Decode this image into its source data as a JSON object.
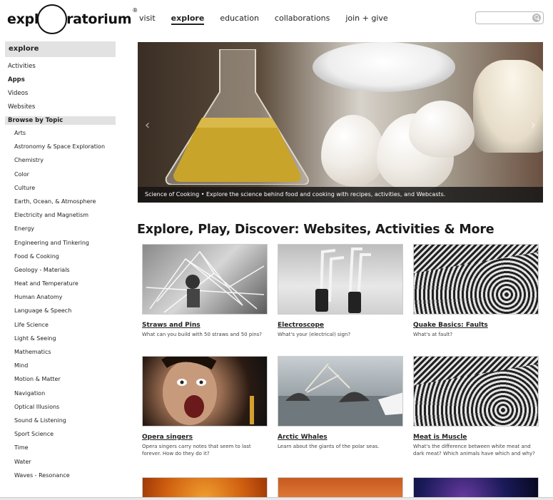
{
  "header": {
    "logo_left": "expl",
    "logo_right": "ratorium",
    "logo_mark": "®",
    "nav": [
      {
        "label": "visit",
        "active": false
      },
      {
        "label": "explore",
        "active": true
      },
      {
        "label": "education",
        "active": false
      },
      {
        "label": "collaborations",
        "active": false
      },
      {
        "label": "join + give",
        "active": false
      }
    ],
    "search_placeholder": "",
    "search_icon": "search-icon"
  },
  "sidebar": {
    "heading": "explore",
    "items": [
      {
        "label": "Activities",
        "bold": false
      },
      {
        "label": "Apps",
        "bold": true
      },
      {
        "label": "Videos",
        "bold": false
      },
      {
        "label": "Websites",
        "bold": false
      }
    ],
    "section": "Browse by Topic",
    "topics": [
      "Arts",
      "Astronomy & Space Exploration",
      "Chemistry",
      "Color",
      "Culture",
      "Earth, Ocean, & Atmosphere",
      "Electricity and Magnetism",
      "Energy",
      "Engineering and Tinkering",
      "Food & Cooking",
      "Geology - Materials",
      "Heat and Temperature",
      "Human Anatomy",
      "Language & Speech",
      "Life Science",
      "Light & Seeing",
      "Mathematics",
      "Mind",
      "Motion & Matter",
      "Navigation",
      "Optical Illusions",
      "Sound & Listening",
      "Sport Science",
      "Time",
      "Water",
      "Waves - Resonance"
    ]
  },
  "hero": {
    "caption": "Science of Cooking • Explore the science behind food and cooking with recipes, activities, and Webcasts.",
    "prev_icon": "chevron-left-icon",
    "next_icon": "chevron-right-icon"
  },
  "main": {
    "title": "Explore, Play, Discover: Websites, Activities & More",
    "cards": [
      {
        "title": "Straws and Pins",
        "desc": "What can you build with 50 straws and 50 pins?"
      },
      {
        "title": "Electroscope",
        "desc": "What's your (electrical) sign?"
      },
      {
        "title": "Quake Basics: Faults",
        "desc": "What's at fault?"
      },
      {
        "title": "Opera singers",
        "desc": "Opera singers carry notes that seem to last forever. How do they do it?"
      },
      {
        "title": "Arctic Whales",
        "desc": "Learn about the giants of the polar seas."
      },
      {
        "title": "Meat is Muscle",
        "desc": "What's the difference between white meat and dark meat? Which animals have which and why?"
      }
    ]
  },
  "colors": {
    "sidebar_bg": "#e2e2e2",
    "caption_bg": "#141414",
    "text": "#222222"
  }
}
